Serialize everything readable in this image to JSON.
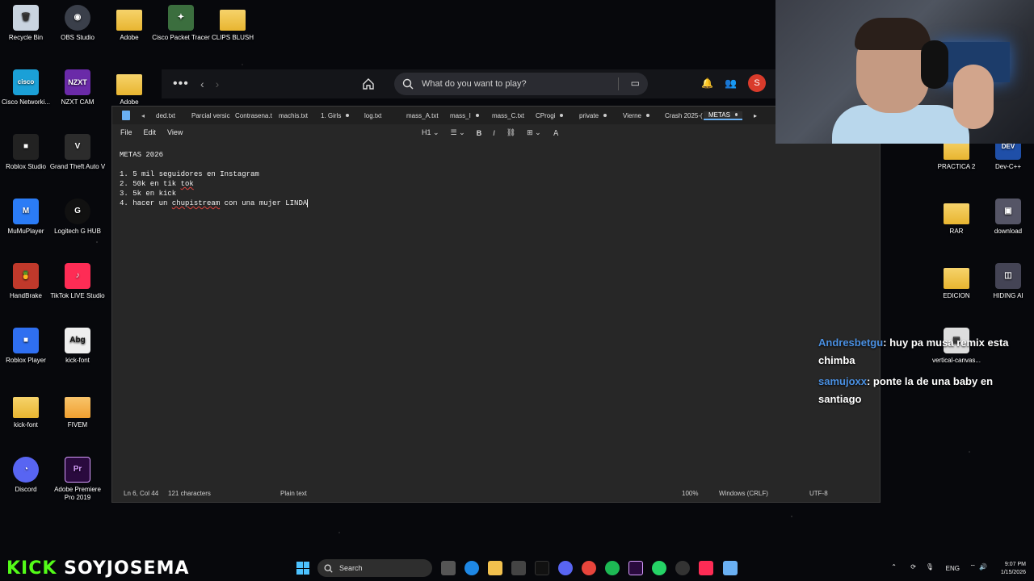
{
  "desktop": {
    "icons": [
      {
        "label": "Recycle Bin",
        "icon": "recycle-bin-icon",
        "color": "#c9d4e0"
      },
      {
        "label": "OBS Studio",
        "icon": "obs-icon",
        "color": "#3a3f4a"
      },
      {
        "label": "Adobe",
        "icon": "folder-icon",
        "color": "#f6d36b"
      },
      {
        "label": "Cisco Packet Tracer",
        "icon": "cisco-packet-tracer-icon",
        "color": "#3b6e3e"
      },
      {
        "label": "CLIPS BLUSH",
        "icon": "folder-icon",
        "color": "#f6d36b"
      },
      {
        "label": "Cisco Networki...",
        "icon": "cisco-icon",
        "color": "#1ba0d7"
      },
      {
        "label": "NZXT CAM",
        "icon": "nzxt-icon",
        "color": "#6a2aa8"
      },
      {
        "label": "Adobe",
        "icon": "folder-icon",
        "color": "#f6d36b"
      },
      {
        "label": "Roblox Studio",
        "icon": "roblox-studio-icon",
        "color": "#222"
      },
      {
        "label": "Grand Theft Auto V",
        "icon": "gta-icon",
        "color": "#2c2c2c"
      },
      {
        "label": "MuMuPlayer",
        "icon": "mumu-icon",
        "color": "#2b7cf6"
      },
      {
        "label": "Logitech G HUB",
        "icon": "logitech-icon",
        "color": "#111"
      },
      {
        "label": "HandBrake",
        "icon": "handbrake-icon",
        "color": "#c0392b"
      },
      {
        "label": "TikTok LIVE Studio",
        "icon": "tiktok-live-icon",
        "color": "#fe2c55"
      },
      {
        "label": "Roblox Player",
        "icon": "roblox-player-icon",
        "color": "#2f6ff0"
      },
      {
        "label": "kick-font",
        "icon": "font-file-icon",
        "color": "#eeeeee"
      },
      {
        "label": "kick-font",
        "icon": "folder-icon",
        "color": "#f6d36b"
      },
      {
        "label": "FIVEM",
        "icon": "folder-icon",
        "color": "#f6a93b"
      },
      {
        "label": "Discord",
        "icon": "discord-icon",
        "color": "#5865f2"
      },
      {
        "label": "Adobe Premiere Pro 2019",
        "icon": "premiere-icon",
        "color": "#2a0a3e"
      },
      {
        "label": "PRACTICA 2",
        "icon": "folder-icon",
        "color": "#f6d36b"
      },
      {
        "label": "Dev-C++",
        "icon": "devcpp-icon",
        "color": "#1f4fa8"
      },
      {
        "label": "RAR",
        "icon": "folder-icon",
        "color": "#f6d36b"
      },
      {
        "label": "download",
        "icon": "image-icon",
        "color": "#556"
      },
      {
        "label": "EDICION",
        "icon": "folder-icon",
        "color": "#f6d36b"
      },
      {
        "label": "HIDING AI",
        "icon": "hiding-ai-icon",
        "color": "#445"
      },
      {
        "label": "vertical-canvas...",
        "icon": "file-icon",
        "color": "#ddd"
      }
    ],
    "icon_glyphs": {
      "obs": "◉",
      "nzxt": "NZXT",
      "cisco": "cisco",
      "gta": "V",
      "mumu": "M",
      "logitech": "G",
      "tiktok": "♪",
      "roblox": "■",
      "kickfont": "Abg",
      "discord": "◔",
      "premiere": "Pr",
      "devcpp": "DEV"
    }
  },
  "xbox_bar": {
    "more": "•••",
    "back": "‹",
    "forward": "›",
    "search_placeholder": "What do you want to play?",
    "avatar_letter": "S"
  },
  "notepad": {
    "tabs": [
      "ded.txt",
      "Parcial versic",
      "Contrasena.t",
      "machis.txt",
      "1. Girls",
      "log.txt",
      "mass_A.txt",
      "mass_I",
      "mass_C.txt",
      "CProgi",
      "private",
      "Vierne",
      "Crash 2025-(",
      "METAS"
    ],
    "menu": {
      "file": "File",
      "edit": "Edit",
      "view": "View"
    },
    "format": {
      "heading": "H1",
      "bold": "B",
      "italic": "I"
    },
    "content": {
      "title": "METAS 2026",
      "line1": "1. 5 mil seguidores en Instagram",
      "line2_a": "2. 50k en tik ",
      "line2_b": "tok",
      "line3": "3. 5k en kick",
      "line4_a": "4. hacer un ",
      "line4_b": "chupistream",
      "line4_c": " con una mujer LINDA"
    },
    "status": {
      "position": "Ln 6, Col 44",
      "chars": "121 characters",
      "mode": "Plain text",
      "zoom": "100%",
      "line_ending": "Windows (CRLF)",
      "encoding": "UTF-8"
    }
  },
  "chat": [
    {
      "user": "Andresbetgu",
      "message": ": huy pa musa remix esta chimba"
    },
    {
      "user": "samujoxx",
      "message": ": ponte la de una baby en santiago"
    }
  ],
  "branding": {
    "kick": "KICK",
    "channel": "SOYJOSEMA"
  },
  "taskbar": {
    "search": "Search",
    "language": "ENG",
    "time": "9:07 PM",
    "date": "1/15/2026"
  }
}
